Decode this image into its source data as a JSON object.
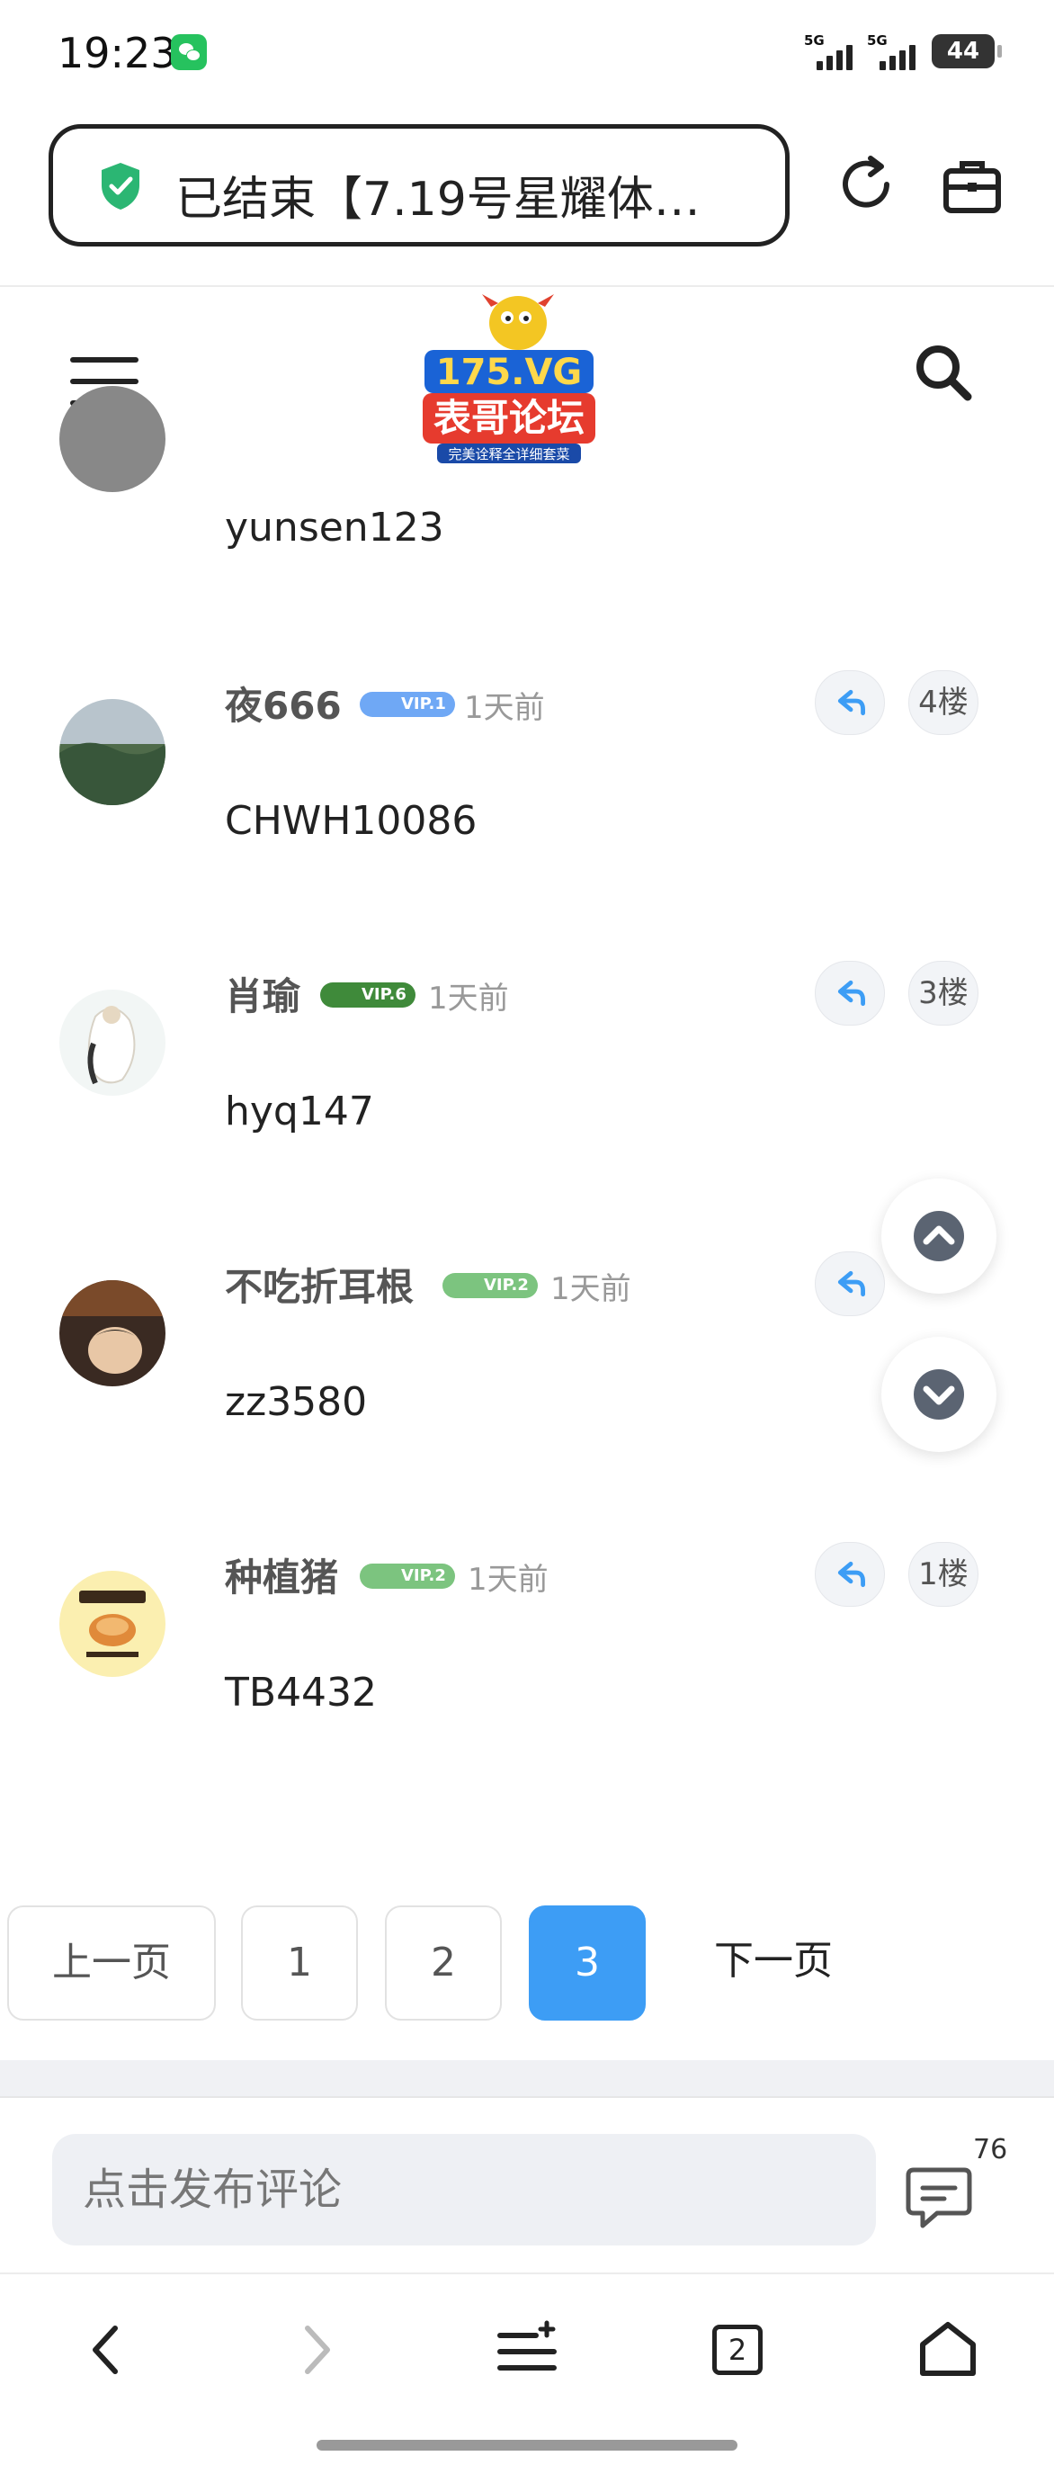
{
  "status_bar": {
    "time": "19:23",
    "network_1": "5G",
    "network_2": "5G",
    "battery": "44"
  },
  "browser": {
    "page_title": "已结束【7.19号星耀体…",
    "tabs_count": "2"
  },
  "site": {
    "logo_text_1": "175.VG",
    "logo_text_2": "表哥论坛",
    "logo_text_3": "完美诠释全详细套菜"
  },
  "comments": [
    {
      "name": "",
      "vip": "",
      "time": "",
      "floor": "",
      "text": "yunsen123"
    },
    {
      "name": "夜666",
      "vip": "VIP.1",
      "time": "1天前",
      "floor": "4楼",
      "text": "CHWH10086"
    },
    {
      "name": "肖瑜",
      "vip": "VIP.6",
      "time": "1天前",
      "floor": "3楼",
      "text": "hyq147"
    },
    {
      "name": "不吃折耳根",
      "vip": "VIP.2",
      "time": "1天前",
      "floor": "",
      "text": "zz3580"
    },
    {
      "name": "种植猪",
      "vip": "VIP.2",
      "time": "1天前",
      "floor": "1楼",
      "text": "TB4432"
    }
  ],
  "pagination": {
    "prev": "上一页",
    "pages": [
      "1",
      "2",
      "3"
    ],
    "current": "3",
    "next": "下一页"
  },
  "comment_bar": {
    "placeholder": "点击发布评论",
    "count": "76"
  },
  "colors": {
    "accent": "#3d9df5",
    "vip1": "#6fa8f5",
    "vip2": "#7cc47f",
    "vip6": "#3f8a3a"
  }
}
